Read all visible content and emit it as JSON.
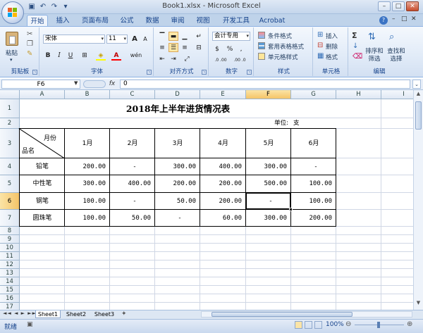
{
  "window": {
    "title": "Book1.xlsx - Microsoft Excel"
  },
  "tabs": [
    "开始",
    "插入",
    "页面布局",
    "公式",
    "数据",
    "审阅",
    "视图",
    "开发工具",
    "Acrobat"
  ],
  "ribbon": {
    "clipboard": {
      "label": "剪贴板",
      "paste": "粘贴"
    },
    "font": {
      "label": "字体",
      "name": "宋体",
      "size": "11",
      "bold": "B",
      "italic": "I",
      "underline": "U",
      "grow": "A",
      "shrink": "A",
      "phonetic": "wén"
    },
    "alignment": {
      "label": "对齐方式"
    },
    "number": {
      "label": "数字",
      "format": "会计专用",
      "currency": "$",
      "percent": "%",
      "comma": ",",
      "inc_dec": ".0 .00",
      "dec_dec": ".00 .0"
    },
    "styles": {
      "label": "样式",
      "conditional": "条件格式",
      "table": "套用表格格式",
      "cell": "单元格样式"
    },
    "cells": {
      "label": "单元格",
      "insert": "插入",
      "delete": "删除",
      "format": "格式"
    },
    "editing": {
      "label": "编辑",
      "sum": "Σ",
      "sort": "排序和筛选",
      "find": "查找和选择"
    }
  },
  "formula_bar": {
    "name_box": "F6",
    "fx": "fx",
    "value": "0"
  },
  "columns": [
    "A",
    "B",
    "C",
    "D",
    "E",
    "F",
    "G",
    "H",
    "I"
  ],
  "rows": [
    "1",
    "2",
    "3",
    "4",
    "5",
    "6",
    "7",
    "8",
    "9",
    "10",
    "11",
    "12",
    "13",
    "14",
    "15",
    "16",
    "17"
  ],
  "sheet": {
    "title": "2018年上半年进货情况表",
    "unit_label": "单位:",
    "unit_value": "支",
    "header_month": "月份",
    "header_name": "品名",
    "months": [
      "1月",
      "2月",
      "3月",
      "4月",
      "5月",
      "6月"
    ],
    "items": [
      {
        "name": "铅笔",
        "values": [
          "200.00",
          "-",
          "300.00",
          "400.00",
          "300.00",
          "-"
        ]
      },
      {
        "name": "中性笔",
        "values": [
          "300.00",
          "400.00",
          "200.00",
          "200.00",
          "500.00",
          "100.00"
        ]
      },
      {
        "name": "钢笔",
        "values": [
          "100.00",
          "-",
          "50.00",
          "200.00",
          "-",
          "100.00"
        ]
      },
      {
        "name": "圆珠笔",
        "values": [
          "100.00",
          "50.00",
          "-",
          "60.00",
          "300.00",
          "200.00"
        ]
      }
    ]
  },
  "sheet_tabs": [
    "Sheet1",
    "Sheet2",
    "Sheet3"
  ],
  "status": {
    "text": "就绪",
    "zoom": "100%"
  },
  "colors": {
    "selected_header": "#f5c468",
    "ribbon_bg": "#e1ebf8",
    "tab_text": "#15428b"
  }
}
